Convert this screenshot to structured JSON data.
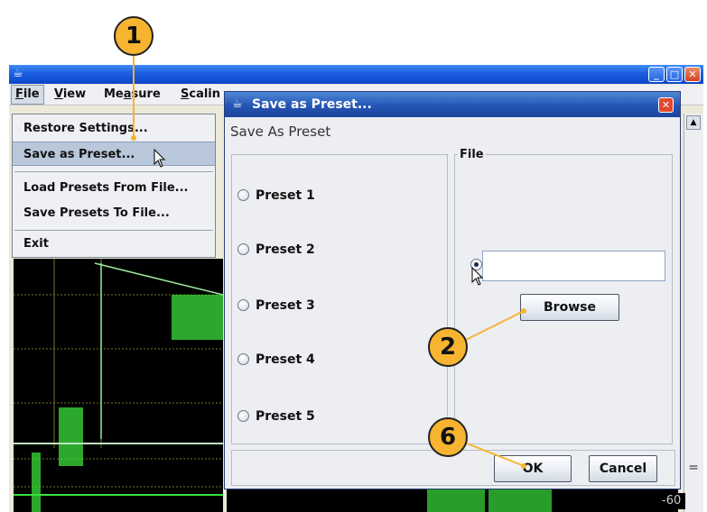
{
  "menubar": {
    "items": [
      {
        "label": "File",
        "mnemonic": "F",
        "rest": "ile"
      },
      {
        "label": "View",
        "mnemonic": "V",
        "rest": "iew"
      },
      {
        "label": "Measure",
        "pre": "Me",
        "mnemonic": "a",
        "rest": "sure"
      },
      {
        "label": "Scalin",
        "mnemonic": "S",
        "rest": "calin"
      }
    ]
  },
  "file_menu": {
    "items": [
      "Restore Settings...",
      "Save as Preset...",
      "Load Presets From File...",
      "Save Presets To File...",
      "Exit"
    ]
  },
  "dialog": {
    "title": "Save as Preset...",
    "heading": "Save As Preset",
    "file_group_title": "File",
    "presets": [
      "Preset 1",
      "Preset 2",
      "Preset 3",
      "Preset 4",
      "Preset 5"
    ],
    "file_input": {
      "value": ""
    },
    "browse_label": "Browse",
    "ok_label": "OK",
    "cancel_label": "Cancel"
  },
  "callouts": [
    "1",
    "2",
    "6"
  ],
  "scale_label": "-60",
  "colors": {
    "callout_fill": "#f7b431",
    "titlebar": "#1c5ee0",
    "dialog_titlebar": "#2455b4",
    "waveform": "#3be03b"
  }
}
